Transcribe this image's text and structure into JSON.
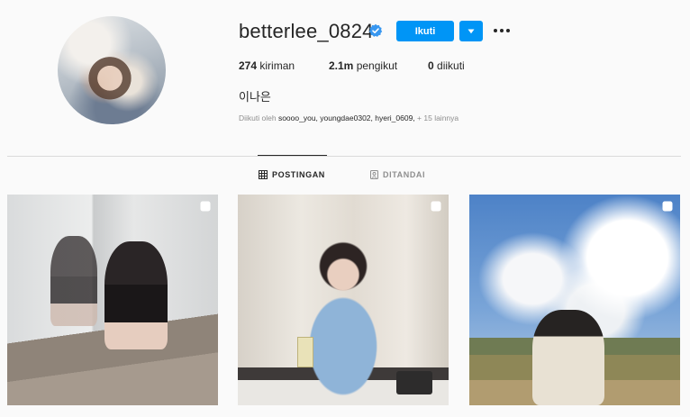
{
  "profile": {
    "username": "betterlee_0824",
    "verified": true,
    "follow_label": "Ikuti",
    "stats": {
      "posts_count": "274",
      "posts_label": "kiriman",
      "followers_count": "2.1m",
      "followers_label": "pengikut",
      "following_count": "0",
      "following_label": "diikuti"
    },
    "display_name": "이나은",
    "followed_by": {
      "prefix": "Diikuti oleh",
      "names": "soooo_you, youngdae0302, hyeri_0609,",
      "more": "+ 15 lainnya"
    }
  },
  "tabs": [
    {
      "label": "POSTINGAN",
      "icon": "grid-icon",
      "active": true
    },
    {
      "label": "DITANDAI",
      "icon": "tag-icon",
      "active": false
    }
  ],
  "colors": {
    "accent": "#0095f6",
    "text": "#262626",
    "muted": "#8e8e8e",
    "background": "#fafafa"
  }
}
